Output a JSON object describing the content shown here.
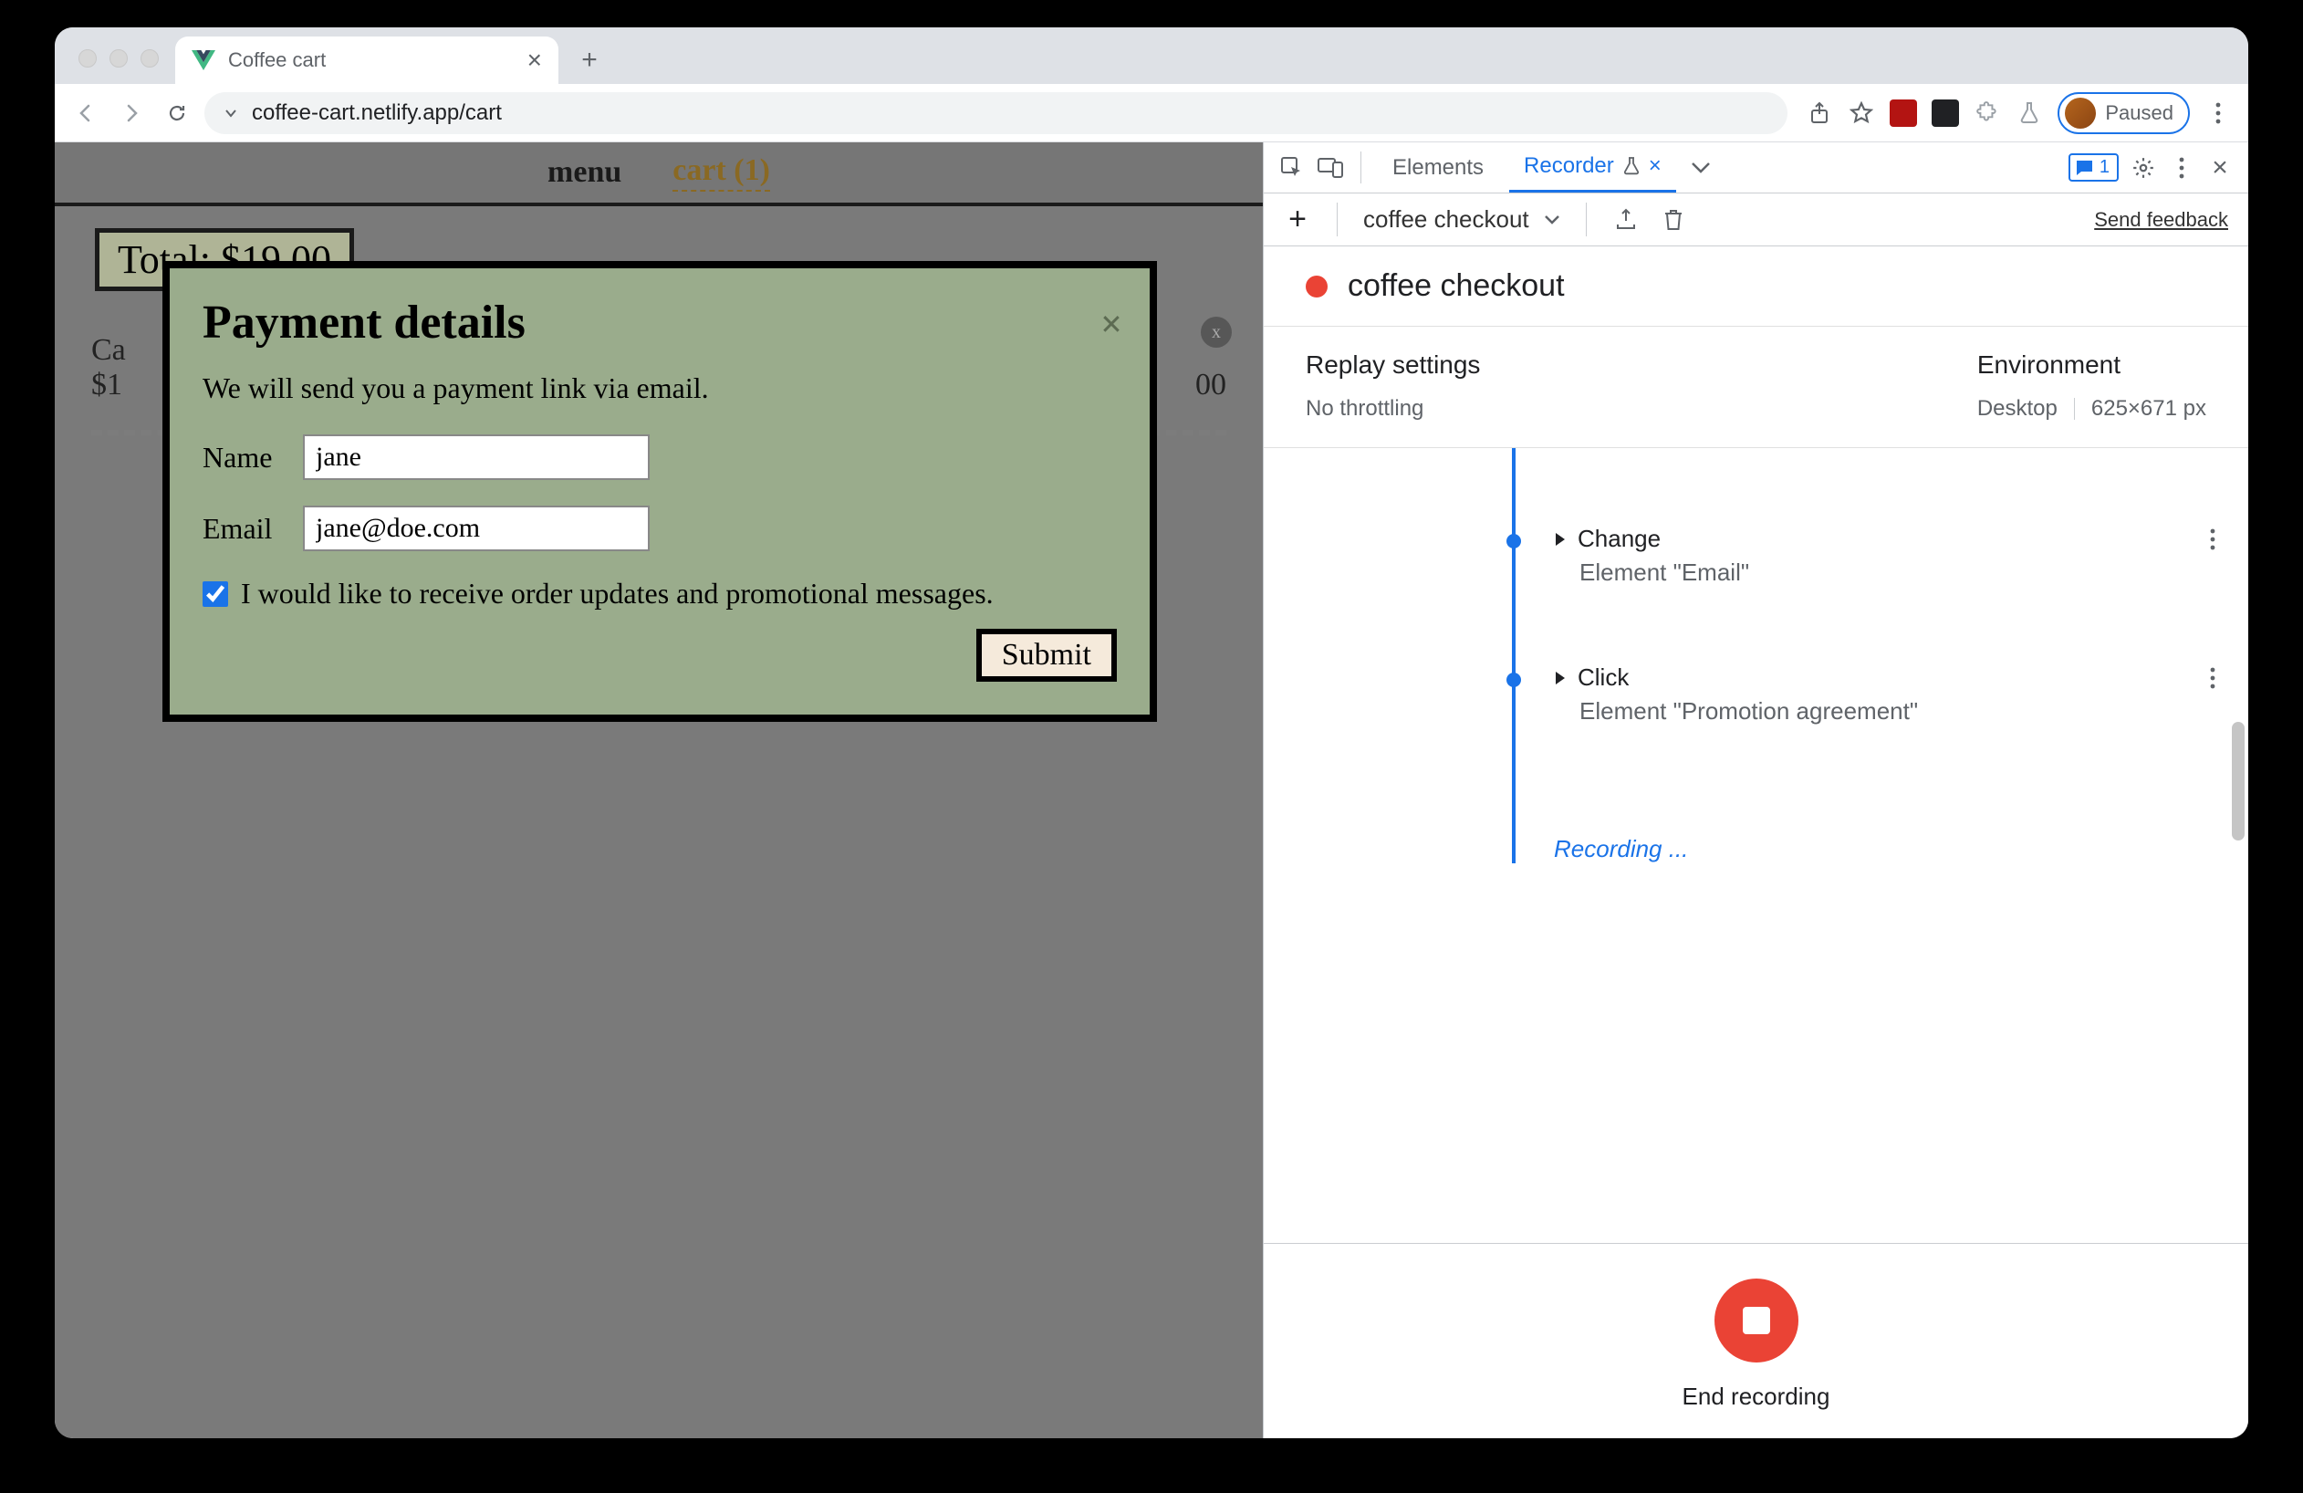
{
  "browser": {
    "tab_title": "Coffee cart",
    "url": "coffee-cart.netlify.app/cart",
    "profile_status": "Paused"
  },
  "page": {
    "nav": {
      "menu": "menu",
      "cart": "cart (1)"
    },
    "total_label": "Total: $19.00",
    "cart_item_left": "Ca",
    "cart_item_price_prefix": "$1",
    "cart_item_right": "00"
  },
  "modal": {
    "title": "Payment details",
    "subtitle": "We will send you a payment link via email.",
    "name_label": "Name",
    "name_value": "jane",
    "email_label": "Email",
    "email_value": "jane@doe.com",
    "promo_label": "I would like to receive order updates and promotional messages.",
    "submit": "Submit"
  },
  "devtools": {
    "tabs": {
      "elements": "Elements",
      "recorder": "Recorder"
    },
    "comment_count": "1",
    "recorder": {
      "recording_name": "coffee checkout",
      "send_feedback": "Send feedback",
      "title": "coffee checkout",
      "settings": {
        "replay_title": "Replay settings",
        "throttling": "No throttling",
        "env_title": "Environment",
        "env_device": "Desktop",
        "env_dims": "625×671 px"
      },
      "steps": [
        {
          "action": "Change",
          "detail": "Element \"Email\""
        },
        {
          "action": "Click",
          "detail": "Element \"Promotion agreement\""
        }
      ],
      "recording_label": "Recording ...",
      "end_label": "End recording"
    }
  }
}
